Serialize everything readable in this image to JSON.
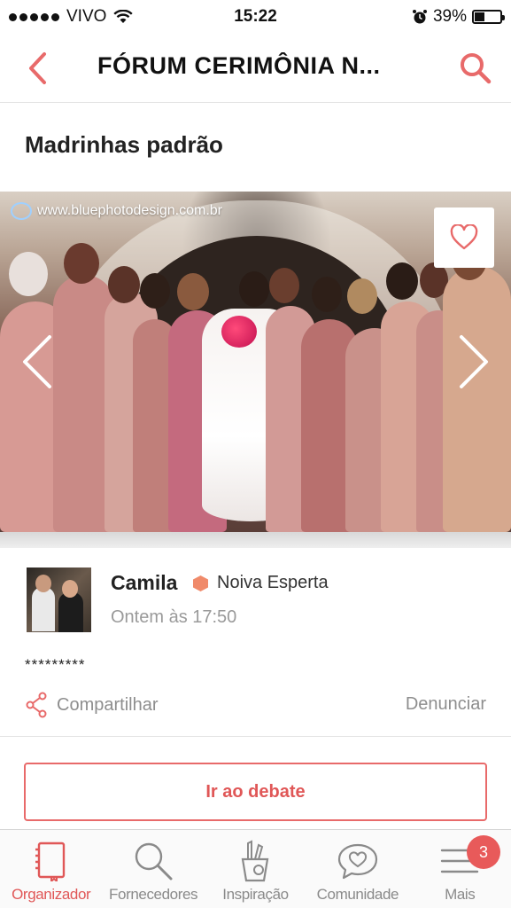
{
  "status_bar": {
    "carrier": "VIVO",
    "time": "15:22",
    "battery_percent": "39%",
    "battery_level": 0.39,
    "signal_bars_filled": 5,
    "icons": [
      "signal-dots-icon",
      "wifi-icon",
      "alarm-icon",
      "battery-icon"
    ]
  },
  "header": {
    "title": "FÓRUM CERIMÔNIA N...",
    "back_icon": "chevron-left-icon",
    "search_icon": "search-icon"
  },
  "post": {
    "title": "Madrinhas padrão",
    "image": {
      "watermark": "www.bluephotodesign.com.br",
      "favorite_icon": "heart-icon",
      "prev_icon": "chevron-left-icon",
      "next_icon": "chevron-right-icon"
    },
    "author": {
      "name": "Camila",
      "badge": "Noiva Esperta",
      "time": "Ontem às 17:50"
    },
    "body": "*********",
    "share_label": "Compartilhar",
    "report_label": "Denunciar",
    "debate_button": "Ir ao debate"
  },
  "tabbar": {
    "tabs": [
      {
        "label": "Organizador",
        "icon": "notebook-icon",
        "active": true
      },
      {
        "label": "Fornecedores",
        "icon": "search-icon",
        "active": false
      },
      {
        "label": "Inspiração",
        "icon": "pencil-cup-icon",
        "active": false
      },
      {
        "label": "Comunidade",
        "icon": "chat-heart-icon",
        "active": false
      },
      {
        "label": "Mais",
        "icon": "menu-icon",
        "active": false,
        "badge": "3"
      }
    ]
  },
  "colors": {
    "accent": "#e05757",
    "badge_hex": "#f08a6a",
    "muted_text": "#8e8e8e"
  }
}
